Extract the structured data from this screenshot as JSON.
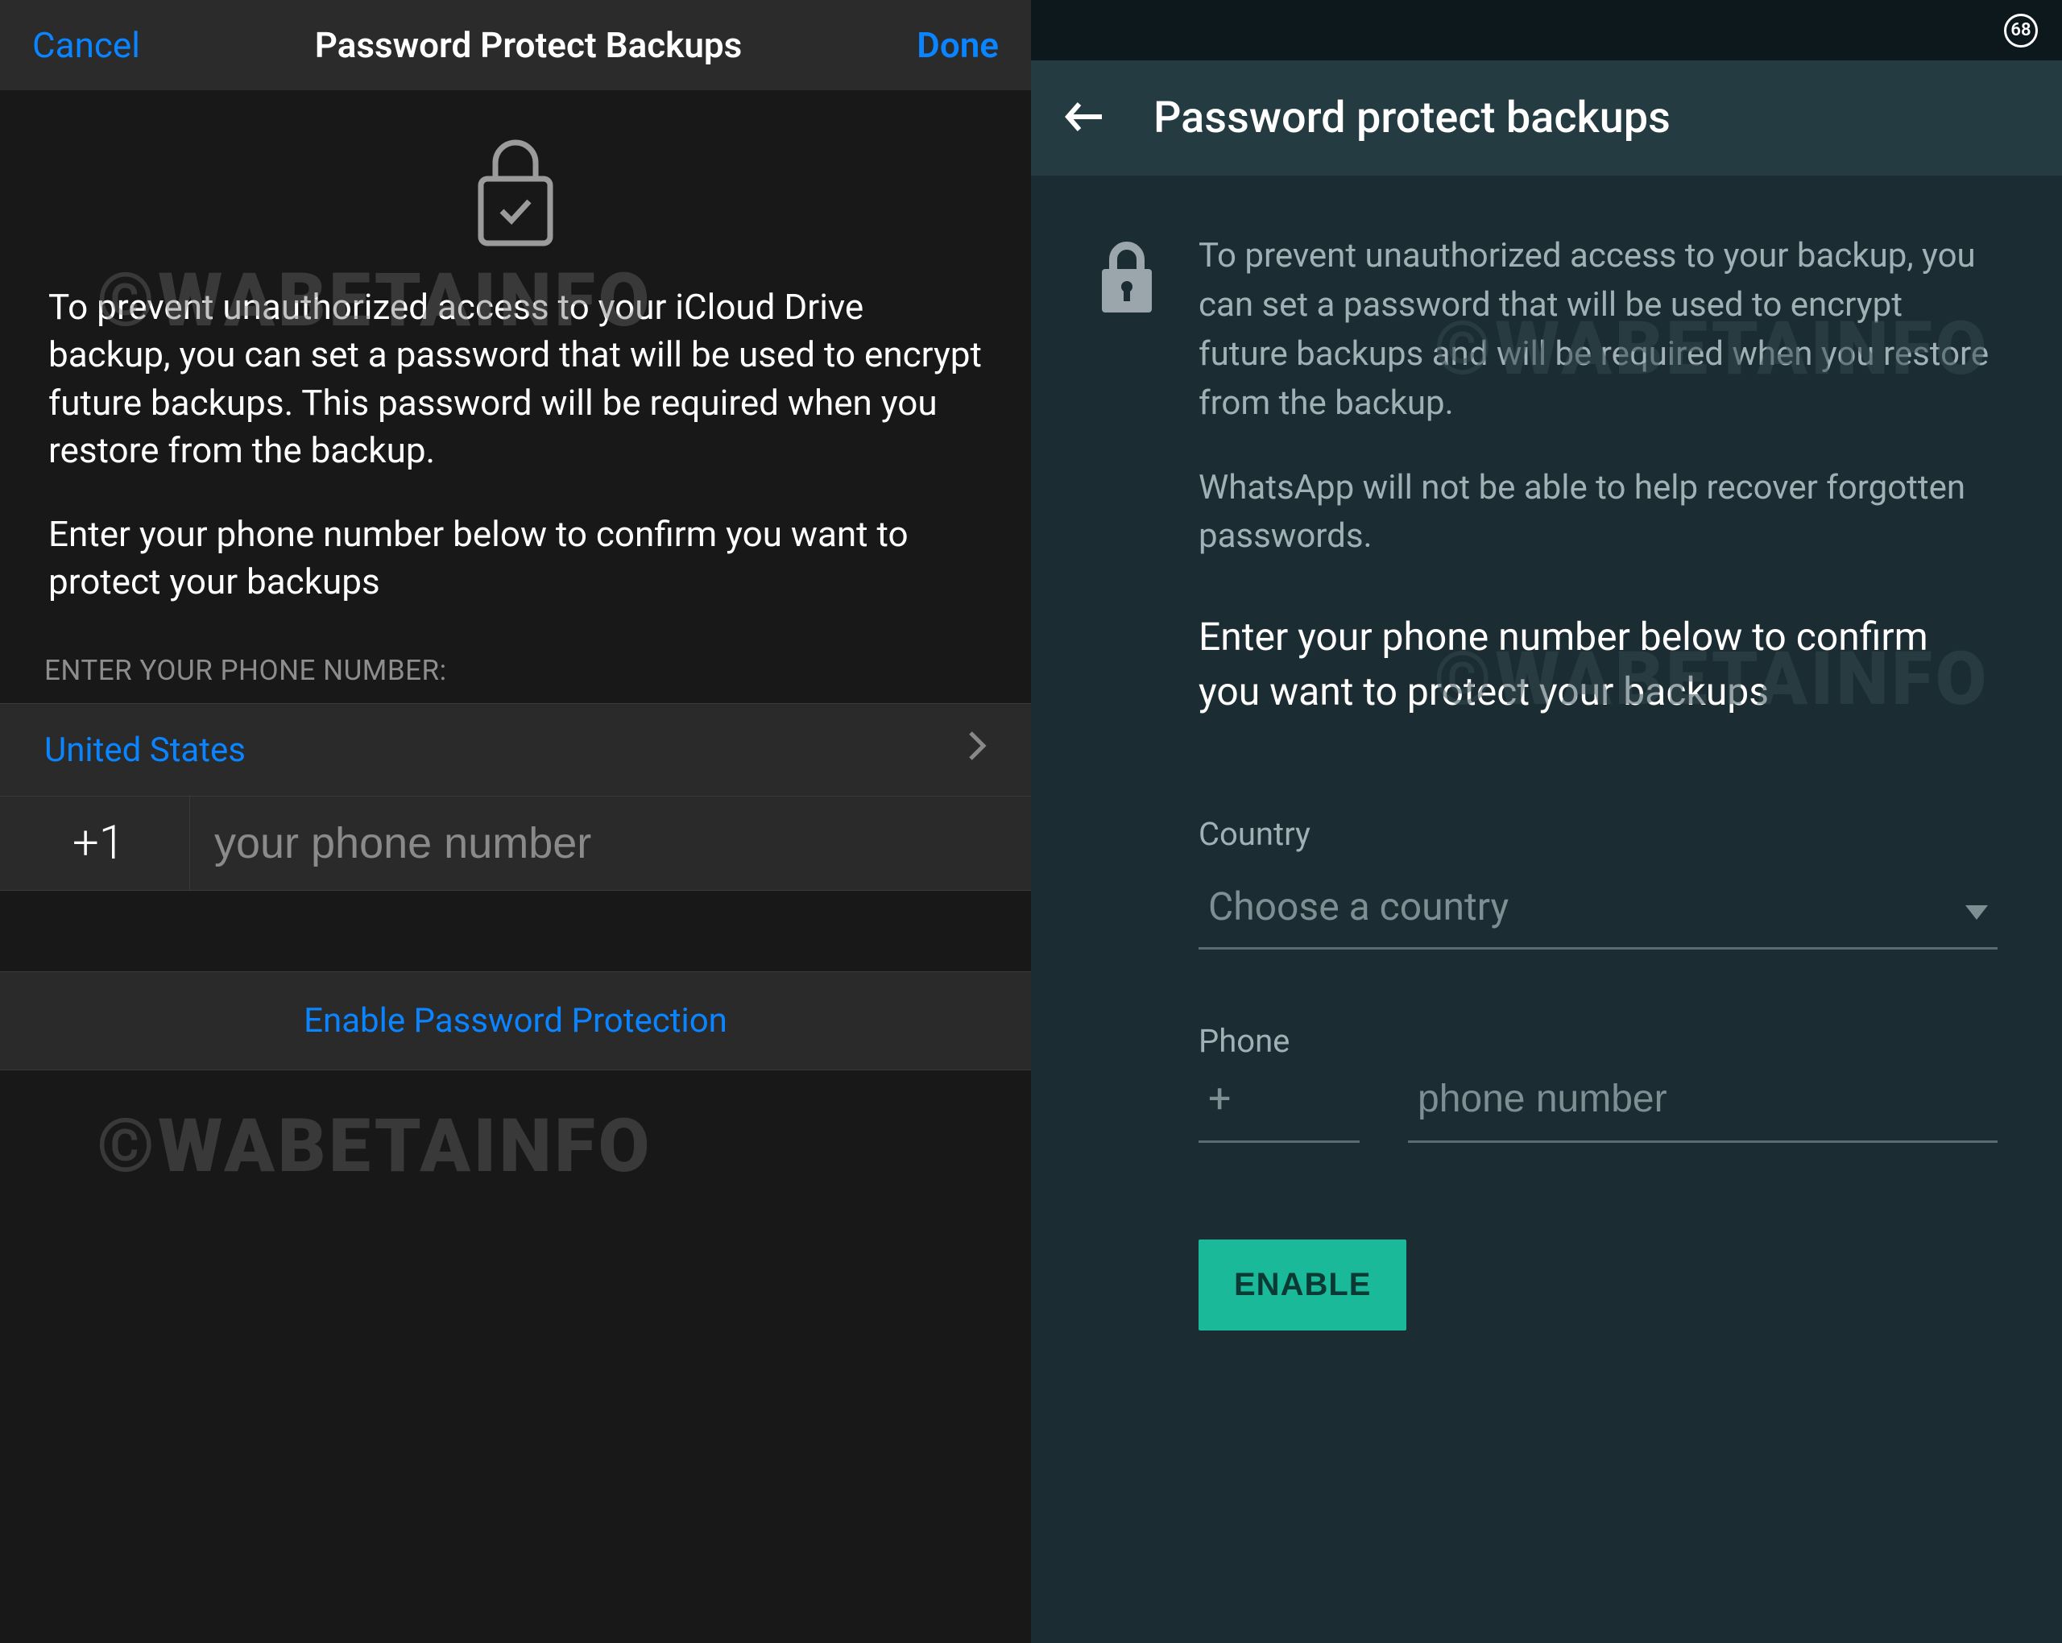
{
  "watermark": "©WABETAINFO",
  "ios": {
    "cancel": "Cancel",
    "done": "Done",
    "title": "Password Protect Backups",
    "desc1": "To prevent unauthorized access to your iCloud Drive backup, you can set a password that will be used to encrypt future backups. This password will be required when you restore from the backup.",
    "desc2": "Enter your phone number below to confirm you want to protect your backups",
    "phone_label": "ENTER YOUR PHONE NUMBER:",
    "country": "United States",
    "prefix": "+1",
    "phone_placeholder": "your phone number",
    "enable": "Enable Password Protection"
  },
  "android": {
    "badge": "68",
    "title": "Password protect backups",
    "desc1": "To prevent unauthorized access to your backup, you can set a password that will be used to encrypt future backups and will be required when you restore from the backup.",
    "desc2": "WhatsApp will not be able to help recover forgotten passwords.",
    "confirm": "Enter your phone number below to confirm you want to protect your backups",
    "country_label": "Country",
    "country_placeholder": "Choose a country",
    "phone_label": "Phone",
    "prefix": "+",
    "phone_placeholder": "phone number",
    "enable": "ENABLE"
  }
}
